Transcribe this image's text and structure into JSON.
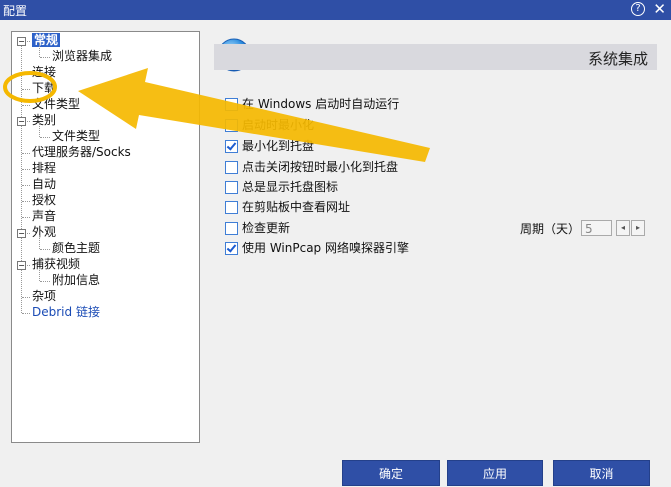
{
  "window": {
    "title": "配置",
    "help_glyph": "?",
    "close_glyph": "✕"
  },
  "tree": [
    {
      "label": "常规",
      "level": 0,
      "expander": "−",
      "selected": true
    },
    {
      "label": "浏览器集成",
      "level": 1
    },
    {
      "label": "连接",
      "level": 0
    },
    {
      "label": "下载",
      "level": 0
    },
    {
      "label": "文件类型",
      "level": 0
    },
    {
      "label": "类别",
      "level": 0,
      "expander": "−"
    },
    {
      "label": "文件类型",
      "level": 1
    },
    {
      "label": "代理服务器/Socks",
      "level": 0
    },
    {
      "label": "排程",
      "level": 0
    },
    {
      "label": "自动",
      "level": 0
    },
    {
      "label": "授权",
      "level": 0
    },
    {
      "label": "声音",
      "level": 0
    },
    {
      "label": "外观",
      "level": 0,
      "expander": "−"
    },
    {
      "label": "颜色主题",
      "level": 1
    },
    {
      "label": "捕获视频",
      "level": 0,
      "expander": "−"
    },
    {
      "label": "附加信息",
      "level": 1
    },
    {
      "label": "杂项",
      "level": 0
    },
    {
      "label": "Debrid 链接",
      "level": 0,
      "link": true
    }
  ],
  "section": {
    "title": "系统集成",
    "icon": "globe-icon"
  },
  "options": [
    {
      "label": "在 Windows 启动时自动运行",
      "checked": false
    },
    {
      "label": "启动时最小化",
      "checked": false
    },
    {
      "label": "最小化到托盘",
      "checked": true
    },
    {
      "label": "点击关闭按钮时最小化到托盘",
      "checked": false
    },
    {
      "label": "总是显示托盘图标",
      "checked": false
    },
    {
      "label": "在剪贴板中查看网址",
      "checked": false
    },
    {
      "label": "检查更新",
      "checked": false
    },
    {
      "label": "使用 WinPcap 网络嗅探器引擎",
      "checked": true
    }
  ],
  "period": {
    "label": "周期（天）",
    "value": "5",
    "left_glyph": "◂",
    "right_glyph": "▸"
  },
  "buttons": {
    "ok": "确定",
    "apply": "应用",
    "cancel": "取消"
  },
  "colors": {
    "titlebar": "#2f4fa6",
    "selection": "#2e62c9",
    "annotation": "#f5b800",
    "link": "#1a4bb5"
  }
}
